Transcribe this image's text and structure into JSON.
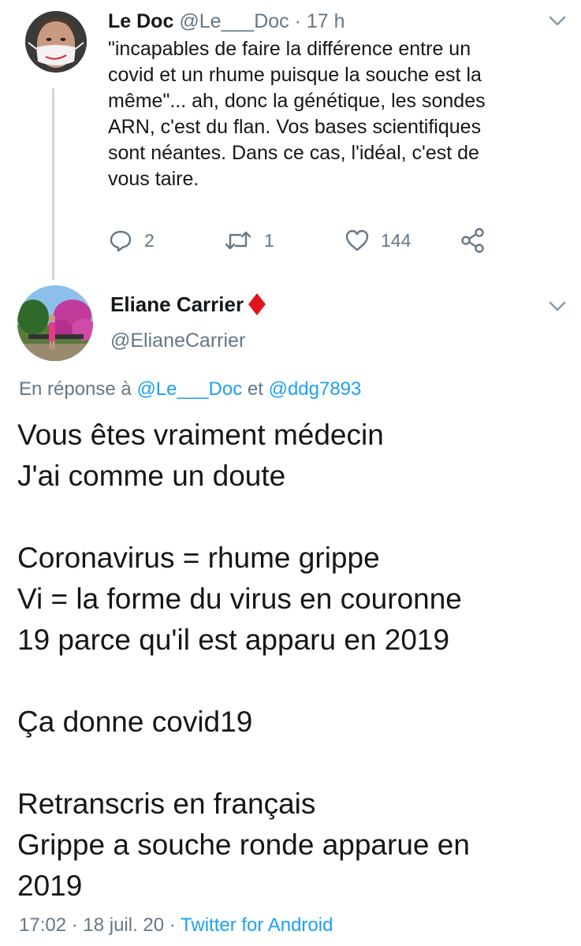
{
  "tweet1": {
    "author_name": "Le Doc",
    "author_handle": "@Le___Doc",
    "separator": " · ",
    "time": "17 h",
    "body_lines": [
      "\"incapables de faire la différence entre un",
      "covid et un rhume puisque la souche est la",
      "même\"... ah, donc la génétique, les sondes",
      "ARN, c'est du flan. Vos bases scientifiques",
      "sont néantes. Dans ce cas, l'idéal, c'est de",
      "vous taire."
    ],
    "actions": {
      "replies": "2",
      "retweets": "1",
      "likes": "144"
    },
    "icons": [
      "reply-icon",
      "retweet-icon",
      "like-icon",
      "share-icon",
      "chevron-down-icon"
    ]
  },
  "tweet2": {
    "author_name": "Eliane Carrier",
    "author_handle": "@ElianeCarrier",
    "reply_prefix": "En réponse à ",
    "reply_user1": "@Le___Doc",
    "reply_conj": " et ",
    "reply_user2": "@ddg7893",
    "body_lines": [
      "Vous êtes vraiment médecin",
      "J'ai comme un doute",
      "",
      "Coronavirus = rhume grippe",
      "Vi = la forme du virus en couronne",
      "19 parce qu'il est apparu en 2019",
      "",
      "Ça donne covid19",
      "",
      "Retranscris en français",
      "Grippe a souche ronde apparue en",
      "2019"
    ],
    "timestamp": "17:02 · 18 juil. 20 · ",
    "client": "Twitter for Android",
    "icons": [
      "red-diamond-icon",
      "chevron-down-icon"
    ]
  },
  "colors": {
    "text": "#14171a",
    "muted": "#657786",
    "link": "#1da1f2",
    "thread_line": "#ccd6dd",
    "diamond": "#e0141e"
  }
}
